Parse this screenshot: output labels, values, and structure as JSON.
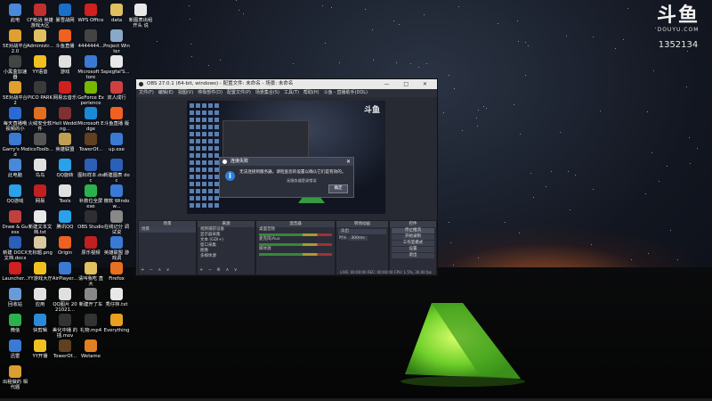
{
  "watermark": {
    "logo": "斗鱼",
    "site": "DOUYU.COM",
    "room_id": "1352134"
  },
  "desktop_icons": [
    {
      "label": "此电",
      "color": "#4a88d8"
    },
    {
      "label": "5E对战平台 2.0",
      "color": "#e0a030"
    },
    {
      "label": "小黑盒加速器",
      "color": "#444"
    },
    {
      "label": "5E对战平台 2",
      "color": "#e0a030"
    },
    {
      "label": "每天直播哦 视频的小",
      "color": "#2b6bd1"
    },
    {
      "label": "Garry's Mod",
      "color": "#3a7ad5"
    },
    {
      "label": "此电脑",
      "color": "#4a88d8"
    },
    {
      "label": "QQ游戏",
      "color": "#2aa1e8"
    },
    {
      "label": "Draw & Guess",
      "color": "#c04040"
    },
    {
      "label": "新建 DOCX 文档.docx",
      "color": "#2b5fb8"
    },
    {
      "label": "Launcher...",
      "color": "#d02020"
    },
    {
      "label": "回收站",
      "color": "#6a9bd8"
    },
    {
      "label": "微信",
      "color": "#2bb24c"
    },
    {
      "label": "迅雷",
      "color": "#3a7ad5"
    },
    {
      "label": "出租做的 相代题",
      "color": "#d9a030"
    },
    {
      "label": "CF枪战 英雄游戏大区",
      "color": "#c03030"
    },
    {
      "label": "Administr...",
      "color": "#e0c060"
    },
    {
      "label": "YY语音",
      "color": "#f0c020"
    },
    {
      "label": "PICO PARK",
      "color": "#3a3a3a"
    },
    {
      "label": "火绒安全软件",
      "color": "#e07020"
    },
    {
      "label": "dicoToolb...",
      "color": "#555"
    },
    {
      "label": "鸟鸟",
      "color": "#e0e0e0"
    },
    {
      "label": "网易",
      "color": "#c02020"
    },
    {
      "label": "新建文本文档.txt",
      "color": "#e8e8e8"
    },
    {
      "label": "无标题.png",
      "color": "#d9c8a0"
    },
    {
      "label": "YY游戏大厅",
      "color": "#f0c020"
    },
    {
      "label": "应用",
      "color": "#e0e0e0"
    },
    {
      "label": "快剪辑",
      "color": "#2a8ad8"
    },
    {
      "label": "YY开播",
      "color": "#f0c020"
    },
    {
      "label": "暴雪战网",
      "color": "#1a70c8"
    },
    {
      "label": "斗鱼直播",
      "color": "#f06020"
    },
    {
      "label": "游戏",
      "color": "#e0e0e0"
    },
    {
      "label": "网易云音乐",
      "color": "#d02020"
    },
    {
      "label": "Hell Wedding...",
      "color": "#803030"
    },
    {
      "label": "英雄联盟",
      "color": "#c0a050"
    },
    {
      "label": "QQ旋转",
      "color": "#2aa1e8"
    },
    {
      "label": "Tools",
      "color": "#e0e0e0"
    },
    {
      "label": "腾讯QQ",
      "color": "#2aa1e8"
    },
    {
      "label": "Origin",
      "color": "#f06020"
    },
    {
      "label": "AirPlayer...",
      "color": "#3a7ad5"
    },
    {
      "label": "QQ图片 2021021...",
      "color": "#e0e0e0"
    },
    {
      "label": "美化中播 的插.mov",
      "color": "#333"
    },
    {
      "label": "TowerOf...",
      "color": "#604020"
    },
    {
      "label": "WPS Office",
      "color": "#d02020"
    },
    {
      "label": "4444444...",
      "color": "#444"
    },
    {
      "label": "Microsoft Store",
      "color": "#3a7ad5"
    },
    {
      "label": "GeForce Experience",
      "color": "#76b900"
    },
    {
      "label": "Microsoft Edge",
      "color": "#1a8ad8"
    },
    {
      "label": "TowerOf...",
      "color": "#604020"
    },
    {
      "label": "图标样本.doc",
      "color": "#2b5fb8"
    },
    {
      "label": "补救位全屏 exe",
      "color": "#2bb24c"
    },
    {
      "label": "OBS Studio",
      "color": "#302e31"
    },
    {
      "label": "原乐视频",
      "color": "#c02020"
    },
    {
      "label": "请叫我吃 直大",
      "color": "#e0c060"
    },
    {
      "label": "新建开了车",
      "color": "#888"
    },
    {
      "label": "礼物.mp4",
      "color": "#333"
    },
    {
      "label": "Wetame",
      "color": "#e08020"
    },
    {
      "label": "data",
      "color": "#e0c060"
    },
    {
      "label": "Project Winter",
      "color": "#8aa8c8"
    },
    {
      "label": "spegfal'S...",
      "color": "#e8e8e8"
    },
    {
      "label": "双人成行",
      "color": "#d04040"
    },
    {
      "label": "斗鱼直播 版",
      "color": "#f06020"
    },
    {
      "label": "up.exe",
      "color": "#3a7ad5"
    },
    {
      "label": "新建图表 doc",
      "color": "#2b5fb8"
    },
    {
      "label": "微软 Window...",
      "color": "#3a7ad5"
    },
    {
      "label": "在线记分 调试说",
      "color": "#888"
    },
    {
      "label": "英雄联盟 游戏调",
      "color": "#3a7ad5"
    },
    {
      "label": "Firefox",
      "color": "#e87020"
    },
    {
      "label": "秀仔林.txt",
      "color": "#e8e8e8"
    },
    {
      "label": "Everything",
      "color": "#e8a020"
    },
    {
      "label": "新图表出组 开头 说",
      "color": "#e8e8e8"
    }
  ],
  "obs": {
    "title": "OBS 27.0.1 (64-bit, windows) - 配置文件: 未命名 - 场景: 未命名",
    "window_controls": "— □ ✕",
    "menu": [
      "文件(F)",
      "编辑(E)",
      "视图(V)",
      "停靠部件(D)",
      "配置文件(P)",
      "场景集合(S)",
      "工具(T)",
      "帮助(H)",
      "斗鱼 - 直播助手(DDL)"
    ],
    "preview_logo": "斗鱼",
    "docks": {
      "scenes": {
        "title": "场景",
        "items": [
          "场景"
        ],
        "controls": "+ − ∧ ∨"
      },
      "sources": {
        "title": "来源",
        "items": [
          "视频捕获设备",
          "显示器采集",
          "文本 (GDI+)",
          "窗口采集",
          "图像",
          "多媒体源"
        ],
        "controls": "+ − ⚙ ∧ ∨"
      },
      "mixer": {
        "title": "混音器",
        "channels": [
          "桌面音频",
          "麦克风/Aux",
          "媒体源"
        ]
      },
      "transitions": {
        "title": "转场动画",
        "type": "淡出",
        "duration_label": "时长",
        "duration": "300ms"
      },
      "controls": {
        "title": "控件",
        "buttons": [
          "停止推流",
          "开始录制",
          "工作室模式",
          "设置",
          "退出"
        ]
      }
    },
    "statusbar": "LIVE: 00:00:00  REC: 00:00:00  CPU: 1.5%, 30.00 fps"
  },
  "dialog": {
    "title": "连接失败",
    "close": "✕",
    "message": "无法连接到服务器，请检查您的设置以确认它们是有效的。",
    "sub": "无服务器登录错误",
    "ok": "确定",
    "info_glyph": "i"
  }
}
